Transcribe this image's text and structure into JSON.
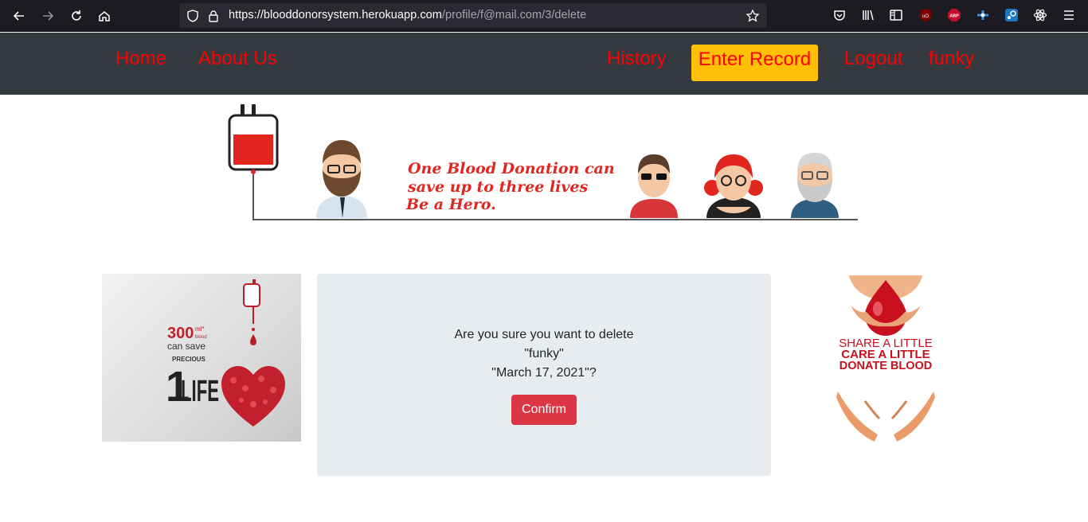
{
  "browser": {
    "url_host": "https://blooddonorsystem.herokuapp.com",
    "url_path": "/profile/f@mail.com/3/delete",
    "icons": [
      "back-icon",
      "forward-icon",
      "reload-icon",
      "home-icon",
      "shield-icon",
      "lock-icon",
      "star-icon",
      "pocket-icon",
      "library-icon",
      "sidebar-icon",
      "ublock-icon",
      "adblock-icon",
      "extension-icon",
      "steam-icon",
      "react-icon",
      "menu-icon"
    ]
  },
  "nav": {
    "home": "Home",
    "about": "About Us",
    "history": "History",
    "enter_record": "Enter Record",
    "logout": "Logout",
    "user": "funky"
  },
  "banner": {
    "line1": "One Blood Donation can",
    "line2": "save up to three lives",
    "line3": "Be a Hero."
  },
  "left_image": {
    "amount": "300",
    "unit": "ml*",
    "sub": "blood",
    "can_save": "can save",
    "precious": "PRECIOUS",
    "number": "1",
    "life": "LIFE"
  },
  "right_image": {
    "line1": "SHARE A LITTLE",
    "line2": "CARE A LITTLE",
    "line3": "DONATE BLOOD"
  },
  "dialog": {
    "question": "Are you sure you want to delete",
    "name": "\"funky\"",
    "date": "\"March 17, 2021\"?",
    "confirm_label": "Confirm"
  },
  "colors": {
    "nav_bg": "#343a40",
    "nav_link": "#ff0000",
    "record_bg": "#ffc107",
    "card_bg": "#e9ecef",
    "confirm_bg": "#dc3545"
  }
}
